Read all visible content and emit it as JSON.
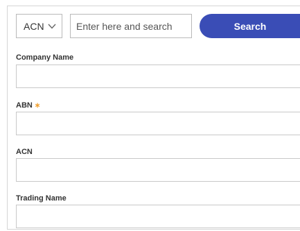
{
  "search": {
    "type_selected": "ACN",
    "placeholder": "Enter here and search",
    "value": "",
    "button_label": "Search"
  },
  "fields": [
    {
      "label": "Company Name",
      "required": false,
      "value": ""
    },
    {
      "label": "ABN",
      "required": true,
      "required_mark": "∗",
      "value": ""
    },
    {
      "label": "ACN",
      "required": false,
      "value": ""
    },
    {
      "label": "Trading Name",
      "required": false,
      "value": ""
    }
  ],
  "colors": {
    "accent": "#3a4db6",
    "required_mark": "#f0a030",
    "border": "#c8c8c8"
  },
  "icons": {
    "select_chevron": "chevron-down-icon"
  }
}
